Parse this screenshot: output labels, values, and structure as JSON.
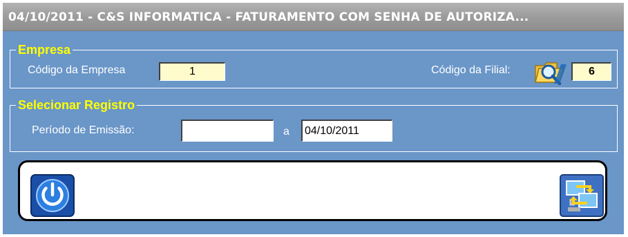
{
  "window": {
    "title": "04/10/2011  -  C&S INFORMATICA  -  FATURAMENTO COM SENHA DE AUTORIZA..."
  },
  "empresa": {
    "title": "Empresa",
    "codigo_empresa_label": "Código da Empresa",
    "codigo_empresa_value": "1",
    "codigo_filial_label": "Código da Filial:",
    "codigo_filial_value": "6"
  },
  "registro": {
    "title": "Selecionar Registro",
    "periodo_label": "Período de Emissão:",
    "periodo_inicio": "",
    "separator": "a",
    "periodo_fim": "04/10/2011"
  },
  "buttons": {
    "power_icon": "power-icon",
    "switch_icon": "switch-screens-icon",
    "search_icon": "folder-search-icon"
  },
  "colors": {
    "window_bg": "#6a96c8",
    "group_title": "#ffff00",
    "field_yellow": "#fffbcc"
  }
}
